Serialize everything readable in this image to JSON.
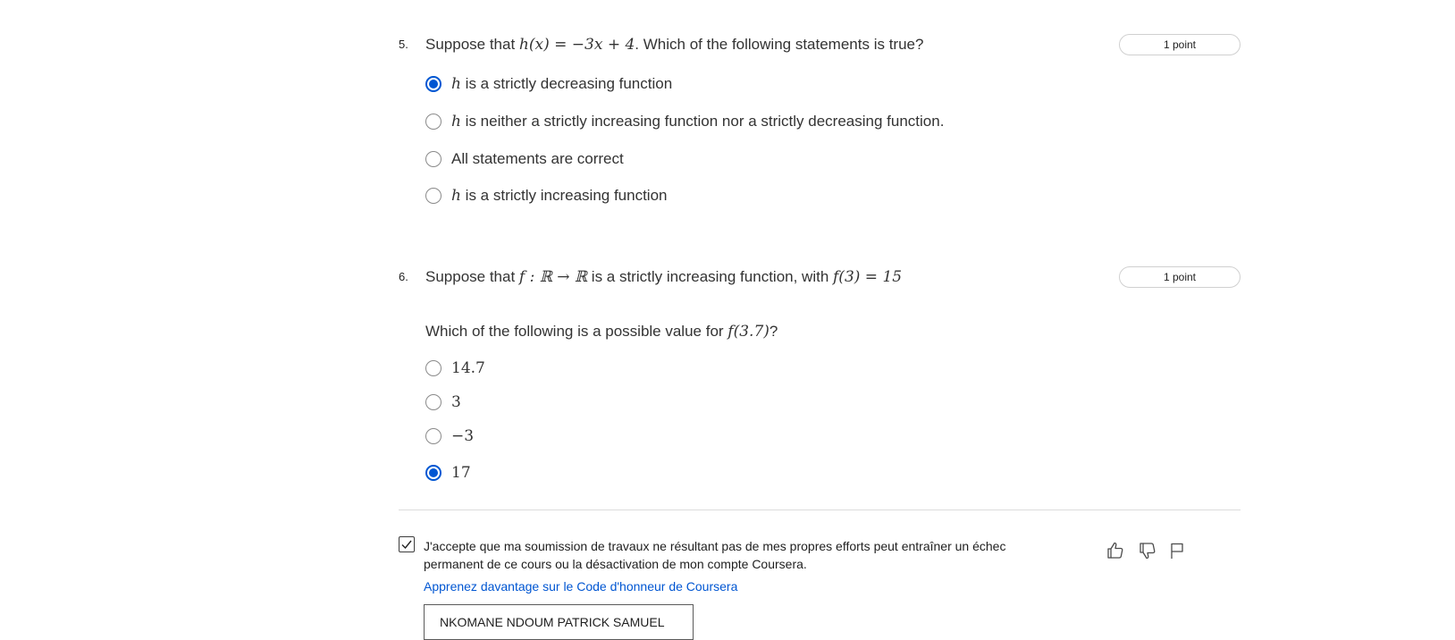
{
  "questions": [
    {
      "number": "5.",
      "points": "1 point",
      "prompt": {
        "before": "Suppose that ",
        "math": "h(x) = −3x + 4",
        "after": ". Which of the following statements is true?"
      },
      "options": [
        {
          "var": "h",
          "text": " is a strictly decreasing function",
          "selected": true
        },
        {
          "var": "h",
          "text": " is neither a strictly increasing function nor a strictly decreasing function.",
          "selected": false
        },
        {
          "var": "",
          "text": "All statements are correct",
          "selected": false
        },
        {
          "var": "h",
          "text": " is a strictly increasing function",
          "selected": false
        }
      ]
    },
    {
      "number": "6.",
      "points": "1 point",
      "prompt": {
        "before": "Suppose that ",
        "math1": "f : ℝ → ℝ",
        "middle": " is a strictly increasing function, with ",
        "math2": "f(3) = 15"
      },
      "subprompt": {
        "before": "Which of the following is a possible value for ",
        "math": "f(3.7)",
        "after": "?"
      },
      "options": [
        {
          "text": "14.7",
          "selected": false
        },
        {
          "text": "3",
          "selected": false
        },
        {
          "text": "−3",
          "selected": false
        },
        {
          "text": "17",
          "selected": true
        }
      ]
    }
  ],
  "honor_code": {
    "checked": true,
    "text": "J'accepte que ma soumission de travaux ne résultant pas de mes propres efforts peut entraîner un échec permanent de ce cours ou la désactivation de mon compte Coursera.",
    "link": "Apprenez davantage sur le Code d'honneur de Coursera",
    "name_value": "NKOMANE NDOUM PATRICK SAMUEL"
  },
  "feedback_icons": [
    "thumbs-up-icon",
    "thumbs-down-icon",
    "flag-icon"
  ],
  "colors": {
    "accent": "#0056d2",
    "text": "#333333",
    "border": "#d0d0d0"
  }
}
